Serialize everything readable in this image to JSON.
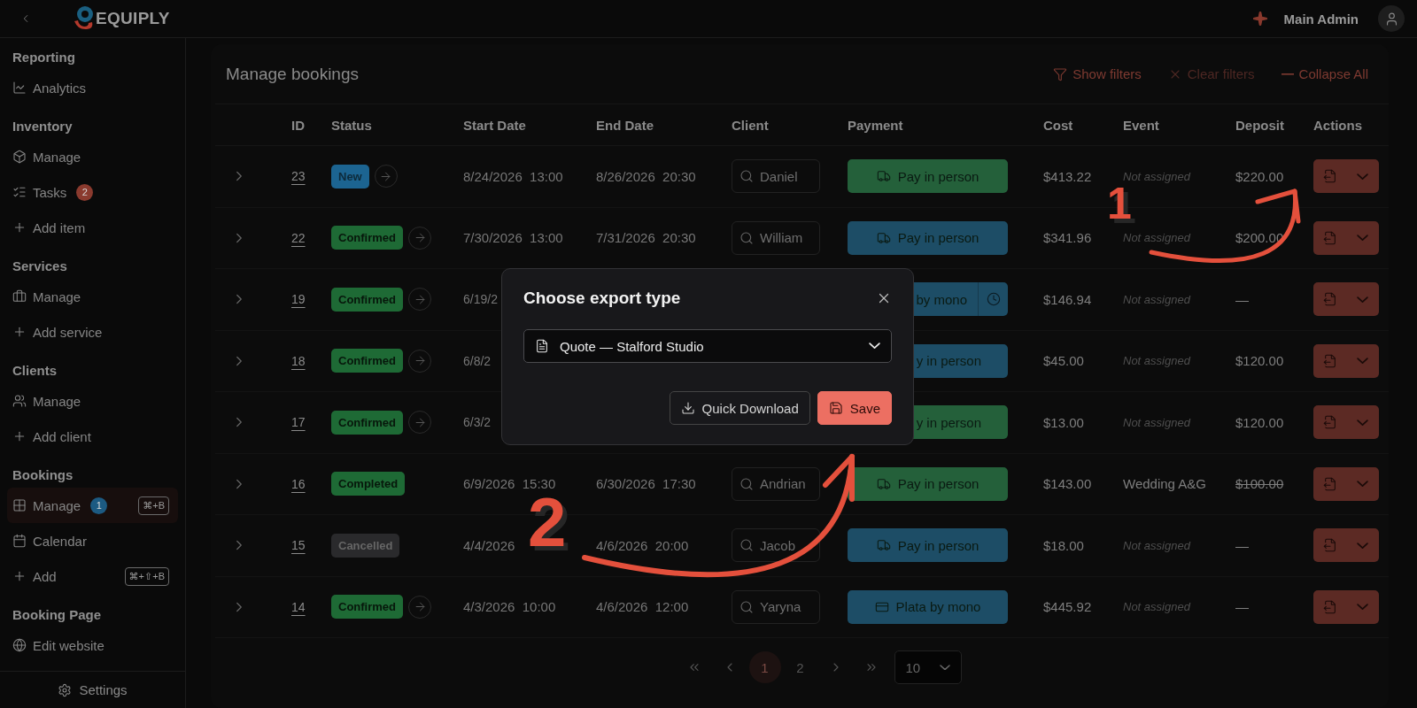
{
  "topbar": {
    "logo_text": "EQUIPLY",
    "user": "Main Admin"
  },
  "sidebar": {
    "sections": [
      {
        "title": "Reporting",
        "items": [
          {
            "label": "Analytics",
            "kind": "chart",
            "selected": false
          }
        ]
      },
      {
        "title": "Inventory",
        "items": [
          {
            "label": "Manage",
            "kind": "box",
            "selected": false
          },
          {
            "label": "Tasks",
            "kind": "tasks",
            "selected": false,
            "badge": {
              "text": "2",
              "color": "#8a3a2e"
            }
          },
          {
            "label": "Add item",
            "kind": "plus",
            "selected": false
          }
        ]
      },
      {
        "title": "Services",
        "items": [
          {
            "label": "Manage",
            "kind": "briefcase",
            "selected": false
          },
          {
            "label": "Add service",
            "kind": "plus",
            "selected": false
          }
        ]
      },
      {
        "title": "Clients",
        "items": [
          {
            "label": "Manage",
            "kind": "users",
            "selected": false
          },
          {
            "label": "Add client",
            "kind": "plus",
            "selected": false
          }
        ]
      },
      {
        "title": "Bookings",
        "items": [
          {
            "label": "Manage",
            "kind": "grid",
            "selected": true,
            "badge": {
              "text": "1",
              "color": "#1c5a82"
            },
            "shortcut": "⌘+B"
          },
          {
            "label": "Calendar",
            "kind": "calendar",
            "selected": false
          },
          {
            "label": "Add",
            "kind": "plus",
            "selected": false,
            "shortcut": "⌘+⇧+B"
          }
        ]
      },
      {
        "title": "Booking Page",
        "items": [
          {
            "label": "Edit website",
            "kind": "globe",
            "selected": false
          }
        ]
      }
    ],
    "footer": "Settings"
  },
  "page": {
    "title": "Manage bookings",
    "actions": [
      {
        "label": "Show filters",
        "kind": "filter",
        "disabled": false
      },
      {
        "label": "Clear filters",
        "kind": "clear",
        "disabled": true
      },
      {
        "label": "Collapse All",
        "kind": "collapse",
        "disabled": false
      }
    ]
  },
  "table": {
    "columns": [
      "ID",
      "Status",
      "Start Date",
      "End Date",
      "Client",
      "Payment",
      "Cost",
      "Event",
      "Deposit",
      "Actions"
    ],
    "rows": [
      {
        "id": "23",
        "status": {
          "label": "New",
          "kind": "new"
        },
        "advance": true,
        "start": "8/24/2026  13:00",
        "end": "8/26/2026  20:30",
        "client": "Daniel",
        "payment": {
          "label": "Pay in person",
          "kind": "truck",
          "color": "#24603a",
          "clipped": false,
          "timer": false
        },
        "cost": "$413.22",
        "event": "Not assigned",
        "event_assigned": false,
        "deposit": "$220.00",
        "deposit_struck": false
      },
      {
        "id": "22",
        "status": {
          "label": "Confirmed",
          "kind": "confirmed"
        },
        "advance": true,
        "start": "7/30/2026  13:00",
        "end": "7/31/2026  20:30",
        "client": "William",
        "payment": {
          "label": "Pay in person",
          "kind": "truck",
          "color": "#1d4d66",
          "clipped": false,
          "timer": false
        },
        "cost": "$341.96",
        "event": "Not assigned",
        "event_assigned": false,
        "deposit": "$200.00",
        "deposit_struck": false
      },
      {
        "id": "19",
        "status": {
          "label": "Confirmed",
          "kind": "confirmed"
        },
        "advance": true,
        "start": "6/19/2",
        "payment": {
          "label": "by mono",
          "kind": "none",
          "color": "#1d4d66",
          "clipped": true,
          "timer": true
        },
        "cost": "$146.94",
        "event": "Not assigned",
        "event_assigned": false,
        "deposit": "—",
        "deposit_struck": false
      },
      {
        "id": "18",
        "status": {
          "label": "Confirmed",
          "kind": "confirmed"
        },
        "advance": true,
        "start": "6/8/2",
        "payment": {
          "label": "y in person",
          "kind": "none",
          "color": "#1d4d66",
          "clipped": true,
          "timer": false
        },
        "cost": "$45.00",
        "event": "Not assigned",
        "event_assigned": false,
        "deposit": "$120.00",
        "deposit_struck": false
      },
      {
        "id": "17",
        "status": {
          "label": "Confirmed",
          "kind": "confirmed"
        },
        "advance": true,
        "start": "6/3/2",
        "payment": {
          "label": "y in person",
          "kind": "none",
          "color": "#24603a",
          "clipped": true,
          "timer": false
        },
        "cost": "$13.00",
        "event": "Not assigned",
        "event_assigned": false,
        "deposit": "$120.00",
        "deposit_struck": false
      },
      {
        "id": "16",
        "status": {
          "label": "Completed",
          "kind": "completed"
        },
        "advance": false,
        "start": "6/9/2026  15:30",
        "end": "6/30/2026  17:30",
        "client": "Andrian",
        "payment": {
          "label": "Pay in person",
          "kind": "truck",
          "color": "#24603a",
          "clipped": false,
          "timer": false
        },
        "cost": "$143.00",
        "event": "Wedding A&G",
        "event_assigned": true,
        "deposit": "$100.00",
        "deposit_struck": true
      },
      {
        "id": "15",
        "status": {
          "label": "Cancelled",
          "kind": "cancelled"
        },
        "advance": false,
        "start": "4/4/2026",
        "end": "4/6/2026  20:00",
        "client": "Jacob",
        "payment": {
          "label": "Pay in person",
          "kind": "truck",
          "color": "#1d4d66",
          "clipped": false,
          "timer": false
        },
        "cost": "$18.00",
        "event": "Not assigned",
        "event_assigned": false,
        "deposit": "—",
        "deposit_struck": false
      },
      {
        "id": "14",
        "status": {
          "label": "Confirmed",
          "kind": "confirmed"
        },
        "advance": true,
        "start": "4/3/2026  10:00",
        "end": "4/6/2026  12:00",
        "client": "Yaryna",
        "payment": {
          "label": "Plata by mono",
          "kind": "card",
          "color": "#1d4d66",
          "clipped": false,
          "timer": false
        },
        "cost": "$445.92",
        "event": "Not assigned",
        "event_assigned": false,
        "deposit": "—",
        "deposit_struck": false
      }
    ]
  },
  "pagination": {
    "pages": [
      {
        "label": "1",
        "selected": true
      },
      {
        "label": "2",
        "selected": false
      }
    ],
    "page_size": "10"
  },
  "modal": {
    "title": "Choose export type",
    "select": "Quote — Stalford Studio",
    "buttons": [
      {
        "label": "Quick Download",
        "kind": "download"
      },
      {
        "label": "Save",
        "kind": "save"
      }
    ]
  },
  "annotations": [
    {
      "label": "1"
    },
    {
      "label": "2"
    }
  ]
}
